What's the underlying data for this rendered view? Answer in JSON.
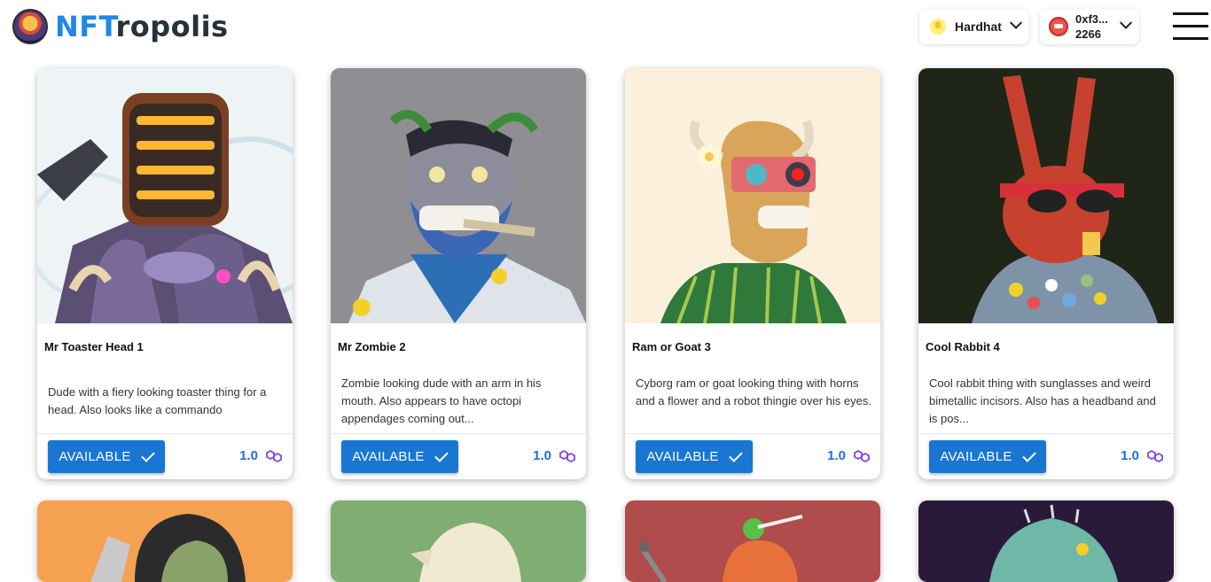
{
  "app": {
    "logo_prefix": "NFT",
    "logo_suffix": "ropolis"
  },
  "header": {
    "network_label": "Hardhat",
    "account_line1": "0xf3...",
    "account_line2": "2266"
  },
  "cards": [
    {
      "title": "Mr Toaster Head 1",
      "description": "Dude with a fiery looking toaster thing for a head. Also looks like a commando",
      "status": "AVAILABLE",
      "price": "1.0"
    },
    {
      "title": "Mr Zombie 2",
      "description": "Zombie looking dude with an arm in his mouth. Also appears to have octopi appendages coming out...",
      "status": "AVAILABLE",
      "price": "1.0"
    },
    {
      "title": "Ram or Goat 3",
      "description": "Cyborg ram or goat looking thing with horns and a flower and a robot thingie over his eyes.",
      "status": "AVAILABLE",
      "price": "1.0"
    },
    {
      "title": "Cool Rabbit 4",
      "description": "Cool rabbit thing with sunglasses and weird bimetallic incisors. Also has a headband and is pos...",
      "status": "AVAILABLE",
      "price": "1.0"
    }
  ],
  "colors": {
    "accent": "#1976d2",
    "logo_blue": "#1e88e5",
    "price_blue": "#1e6fd9",
    "polygon_purple": "#8247e5"
  },
  "icons": {
    "network": "hardhat-icon",
    "account": "account-avatar-icon",
    "menu": "hamburger-menu-icon",
    "available": "check-icon",
    "currency": "polygon-matic-icon"
  }
}
